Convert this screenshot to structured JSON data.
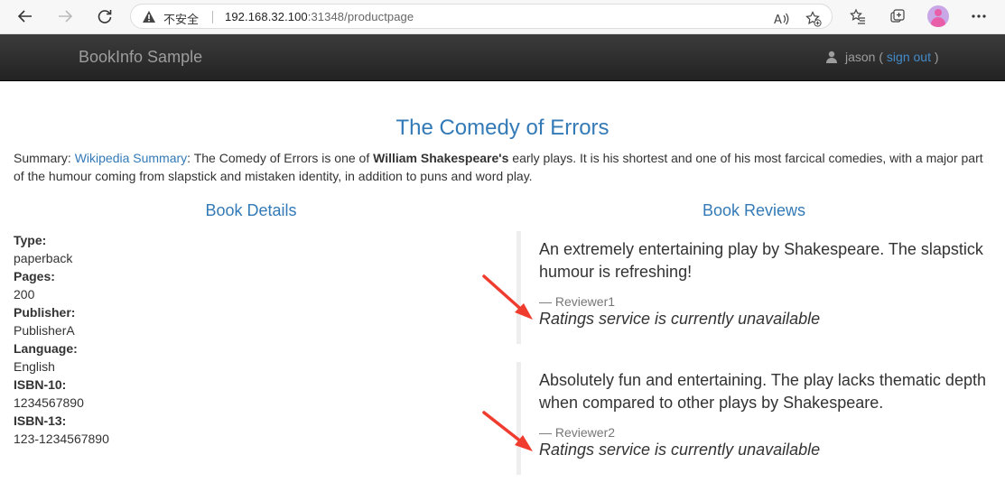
{
  "browser": {
    "security_label": "不安全",
    "url_host": "192.168.32.100",
    "url_rest": ":31348/productpage"
  },
  "navbar": {
    "brand": "BookInfo Sample",
    "user": "jason",
    "open_paren": " ( ",
    "sign_out": "sign out",
    "close_paren": " )"
  },
  "product": {
    "title": "The Comedy of Errors",
    "summary_prefix": "Summary: ",
    "summary_link": "Wikipedia Summary",
    "summary_mid": ": The Comedy of Errors is one of ",
    "summary_author": "William Shakespeare's",
    "summary_rest": " early plays. It is his shortest and one of his most farcical comedies, with a major part of the humour coming from slapstick and mistaken identity, in addition to puns and word play."
  },
  "details": {
    "heading": "Book Details",
    "fields": [
      {
        "label": "Type:",
        "value": "paperback"
      },
      {
        "label": "Pages:",
        "value": "200"
      },
      {
        "label": "Publisher:",
        "value": "PublisherA"
      },
      {
        "label": "Language:",
        "value": "English"
      },
      {
        "label": "ISBN-10:",
        "value": "1234567890"
      },
      {
        "label": "ISBN-13:",
        "value": "123-1234567890"
      }
    ]
  },
  "reviews": {
    "heading": "Book Reviews",
    "items": [
      {
        "text": "An extremely entertaining play by Shakespeare. The slapstick humour is refreshing!",
        "reviewer": "— Reviewer1",
        "rating": "Ratings service is currently unavailable"
      },
      {
        "text": "Absolutely fun and entertaining. The play lacks thematic depth when compared to other plays by Shakespeare.",
        "reviewer": "— Reviewer2",
        "rating": "Ratings service is currently unavailable"
      }
    ]
  },
  "colors": {
    "link": "#337ab7",
    "navbar": "#222222",
    "annotation_arrow": "#f03c2e"
  }
}
